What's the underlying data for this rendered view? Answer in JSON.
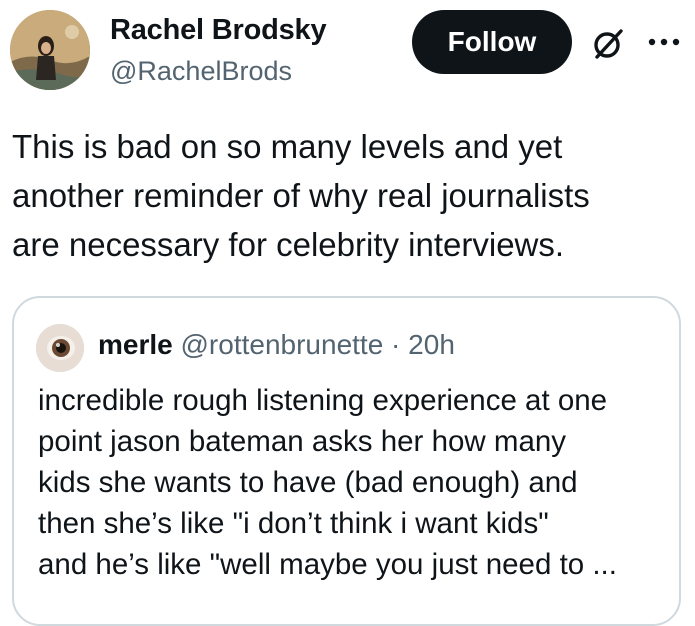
{
  "tweet": {
    "author_name": "Rachel Brodsky",
    "author_handle": "@RachelBrods",
    "follow_label": "Follow",
    "text": "This is bad on so many levels and yet\nanother reminder of why real journalists\nare necessary for celebrity interviews."
  },
  "quote": {
    "author_name": "merle",
    "author_handle": "@rottenbrunette",
    "separator": " · ",
    "time": "20h",
    "text": "incredible rough listening experience at one\npoint jason bateman asks her how many\nkids she wants to have (bad enough) and\nthen she’s like \"i don’t think i want kids\"\nand he’s like \"well maybe you just need to ..."
  },
  "icons": {
    "grok": "grok-icon",
    "more": "more-icon"
  },
  "colors": {
    "text_primary": "#0f1419",
    "text_secondary": "#536471",
    "follow_bg": "#0f1419",
    "border": "#cfd9de"
  }
}
